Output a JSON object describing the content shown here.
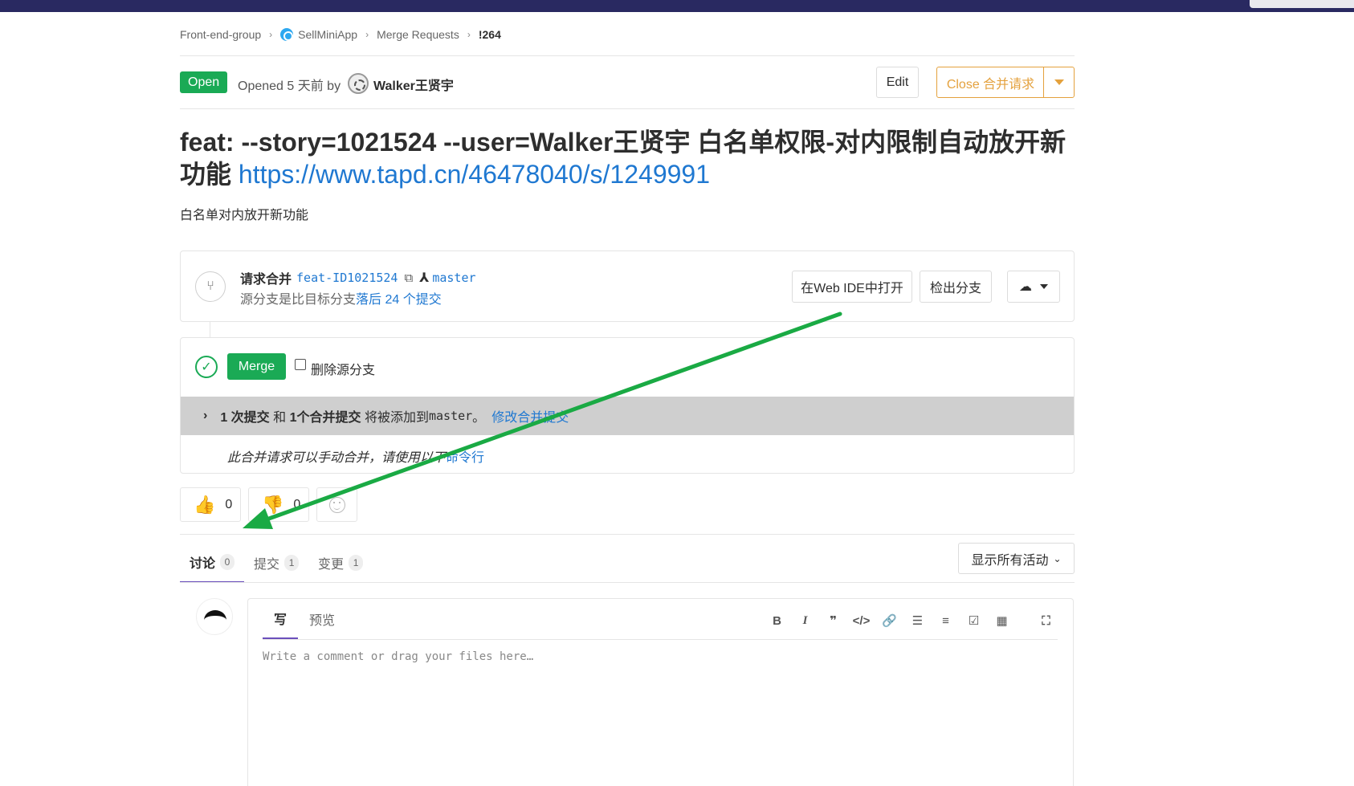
{
  "breadcrumb": {
    "group": "Front-end-group",
    "project": "SellMiniApp",
    "section": "Merge Requests",
    "current": "!264"
  },
  "header": {
    "status": "Open",
    "opened_text": "Opened 5 天前 by",
    "author": "Walker王贤宇",
    "edit_label": "Edit",
    "close_label": "Close 合并请求"
  },
  "title": {
    "text": "feat: --story=1021524 --user=Walker王贤宇 白名单权限-对内限制自动放开新功能",
    "link": "https://www.tapd.cn/46478040/s/1249991"
  },
  "description": "白名单对内放开新功能",
  "branch": {
    "label": "请求合并",
    "source": "feat-ID1021524",
    "target": "master",
    "behind_prefix": "源分支是比目标分支",
    "behind_link": "落后 24 个提交",
    "webide_label": "在Web IDE中打开",
    "checkout_label": "检出分支"
  },
  "merge": {
    "button_label": "Merge",
    "delete_label": "删除源分支",
    "commit_count": "1 次提交",
    "and_text": "和",
    "merge_commit": "1个合并提交",
    "will_add": "将被添加到",
    "target": "master",
    "period": "。",
    "modify_link": "修改合并提交",
    "manual_text": "此合并请求可以手动合并，请使用以下",
    "command_link": "命令行"
  },
  "awards": {
    "thumbsup": "0",
    "thumbsdown": "0"
  },
  "tabs": [
    {
      "label": "讨论",
      "count": "0"
    },
    {
      "label": "提交",
      "count": "1"
    },
    {
      "label": "变更",
      "count": "1"
    }
  ],
  "activity_filter": "显示所有活动",
  "editor": {
    "tab_write": "写",
    "tab_preview": "预览",
    "placeholder": "Write a comment or drag your files here…"
  },
  "colors": {
    "success": "#1aaa55",
    "warning": "#e4a13d",
    "link": "#1f78d1",
    "annotation_arrow": "#1aaa44"
  }
}
